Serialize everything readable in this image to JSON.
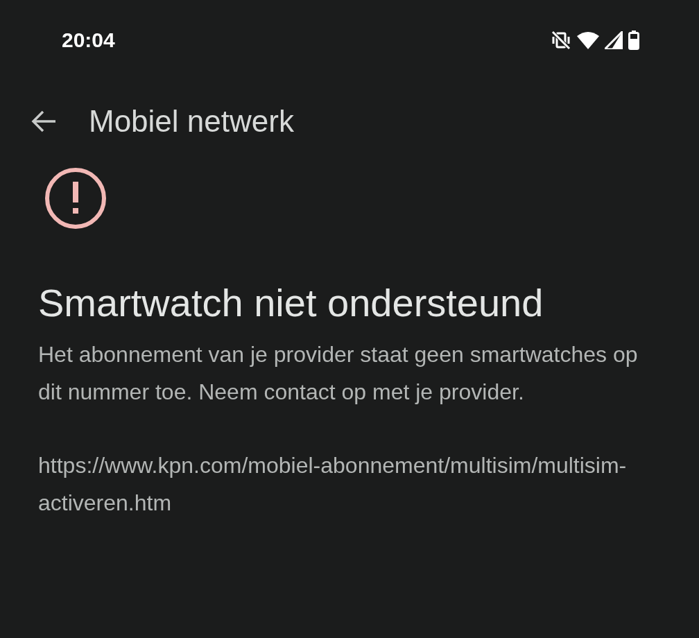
{
  "status_bar": {
    "time": "20:04"
  },
  "toolbar": {
    "title": "Mobiel netwerk"
  },
  "message": {
    "title": "Smartwatch niet ondersteund",
    "body": "Het abonnement van je provider staat geen smartwatches op dit nummer toe. Neem contact op met je provider.",
    "url": "https://www.kpn.com/mobiel-abonnement/multisim/multisim-activeren.htm"
  }
}
